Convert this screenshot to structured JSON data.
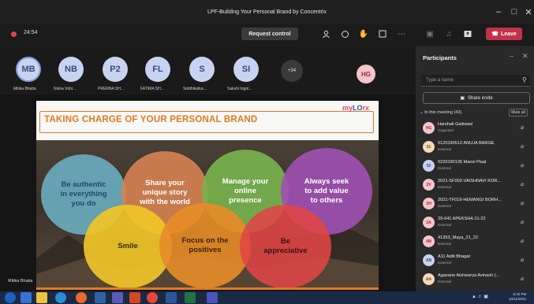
{
  "window": {
    "title": "LPF-Building Your Personal Brand by Concentrix",
    "controls": [
      "minimize-icon",
      "maximize-icon",
      "close-icon"
    ]
  },
  "toolbar": {
    "timer": "24:54",
    "request_control": "Request control",
    "leave": "Leave",
    "icons": [
      "people-icon",
      "chat-icon",
      "reactions-icon",
      "rooms-icon",
      "more-icon",
      "camera-icon",
      "mic-icon",
      "share-icon"
    ]
  },
  "participants_strip": [
    {
      "initials": "MB",
      "label": "Mitika Bhatia",
      "selected": true
    },
    {
      "initials": "NB",
      "label": "Nisha Vohr..."
    },
    {
      "initials": "P2",
      "label": "PRERNA SH..."
    },
    {
      "initials": "FL",
      "label": "FATIMA SH..."
    },
    {
      "initials": "S",
      "label": "Siddhikulka..."
    },
    {
      "initials": "SI",
      "label": "Sakshi Ingol..."
    }
  ],
  "more_count": "+34",
  "self_avatar": "HG",
  "speaker_tag": "Mitika Bhatia",
  "slide": {
    "title": "TAKING CHARGE OF YOUR PERSONAL BRAND",
    "logo_a": "my",
    "logo_b": "LO",
    "logo_c": "rx",
    "bubbles": [
      {
        "text": [
          "Be authentic",
          "in everything",
          "you do"
        ]
      },
      {
        "text": [
          "Share your",
          "unique story",
          "with the world"
        ]
      },
      {
        "text": [
          "Manage your",
          "online",
          "presence"
        ]
      },
      {
        "text": [
          "Always seek",
          "to add value",
          "to others"
        ]
      },
      {
        "text": [
          "Smile"
        ]
      },
      {
        "text": [
          "Focus on the",
          "positives"
        ]
      },
      {
        "text": [
          "Be",
          "appreciative"
        ]
      }
    ]
  },
  "panel": {
    "title": "Participants",
    "search_placeholder": "Type a name",
    "share_invite": "Share invite",
    "in_meeting": "In this meeting (43)",
    "mute_all": "Mute all",
    "people": [
      {
        "initials": "HG",
        "name": "Harshali Gaikwad",
        "role": "Organizer",
        "color": "#f4c6cc",
        "fg": "#9a2b3a"
      },
      {
        "initials": "01",
        "name": "0120190512 ANUJA BARGE",
        "role": "External",
        "color": "#f3d9b8",
        "fg": "#7a4a1a"
      },
      {
        "initials": "02",
        "name": "0220190136 Mansi Pisal",
        "role": "External",
        "color": "#c7d3f0",
        "fg": "#3a4a7a"
      },
      {
        "initials": "2V",
        "name": "2021-SF003-VAISHNAVI KOR...",
        "role": "External",
        "color": "#f4c6cc",
        "fg": "#9a2b3a"
      },
      {
        "initials": "2H",
        "name": "2021-TF019-HEMANGI BORH...",
        "role": "External",
        "color": "#f4c6cc",
        "fg": "#9a2b3a"
      },
      {
        "initials": "2A",
        "name": "29-641 APEKSHA 21-22",
        "role": "External",
        "color": "#f4c6cc",
        "fg": "#9a2b3a"
      },
      {
        "initials": "4M",
        "name": "41353_Maya_21_22",
        "role": "External",
        "color": "#f4c6cc",
        "fg": "#9a2b3a"
      },
      {
        "initials": "AB",
        "name": "A11 Aditi Bhagat",
        "role": "External",
        "color": "#c7d3f0",
        "fg": "#3a4a7a"
      },
      {
        "initials": "AA",
        "name": "Agavane Aishwarya Avinash (...",
        "role": "External",
        "color": "#f3d9b8",
        "fg": "#7a4a1a"
      }
    ]
  },
  "taskbar": {
    "time": "5:40 PM",
    "date": "10/11/2021",
    "apps": [
      "start-icon",
      "search-icon",
      "file-explorer-icon",
      "edge-icon",
      "firefox-icon",
      "media-icon",
      "teams-icon",
      "powerpoint-icon",
      "chrome-icon",
      "word-icon",
      "excel-icon",
      "teams-active-icon"
    ]
  }
}
